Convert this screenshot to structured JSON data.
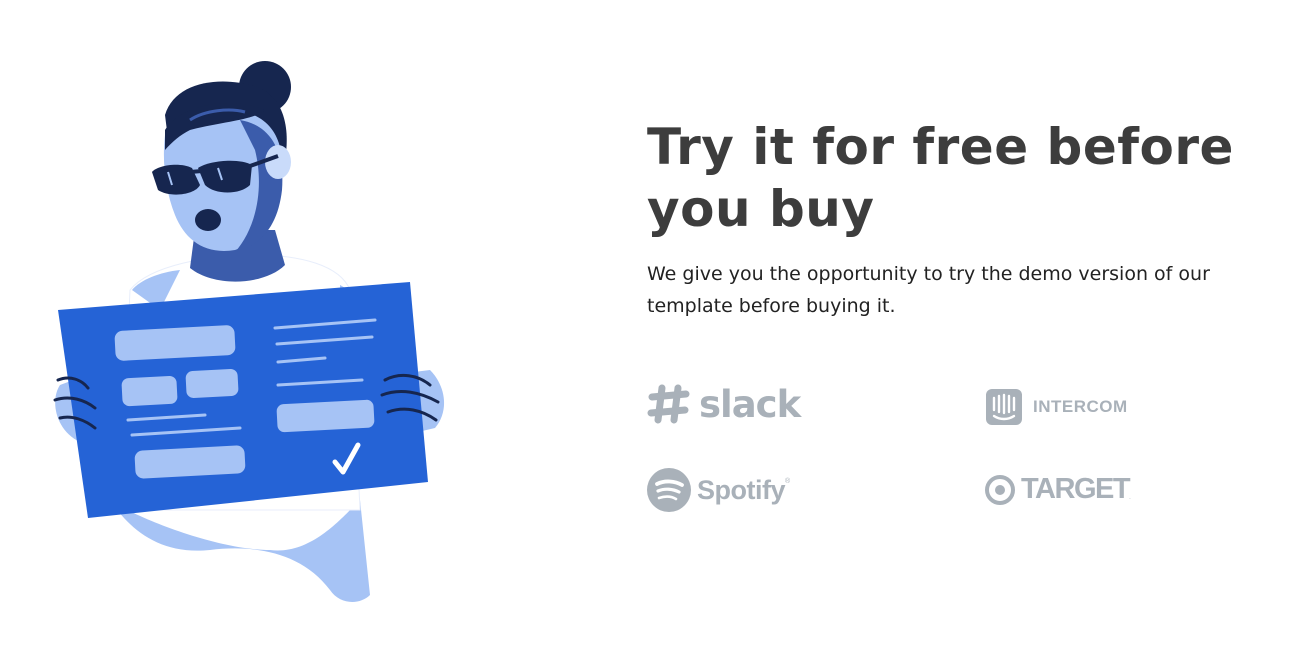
{
  "hero": {
    "headline": "Try it for free before you buy",
    "subtext": "We give you the opportunity to try the demo version of our template before buying it."
  },
  "logos": {
    "slack": {
      "text": "slack",
      "icon": "slack-hash-icon"
    },
    "intercom": {
      "text": "INTERCOM",
      "icon": "intercom-icon"
    },
    "spotify": {
      "text": "Spotify",
      "mark": "®",
      "icon": "spotify-icon"
    },
    "target": {
      "text": "TARGET",
      "mark": ".",
      "icon": "target-bullseye-icon"
    }
  },
  "colors": {
    "heading": "#3d3d3d",
    "body_text": "#222222",
    "logo_gray": "#a9b1b9",
    "illustration_blue": "#2563d6",
    "illustration_light_blue": "#a6c3f5",
    "illustration_navy": "#16264f"
  }
}
